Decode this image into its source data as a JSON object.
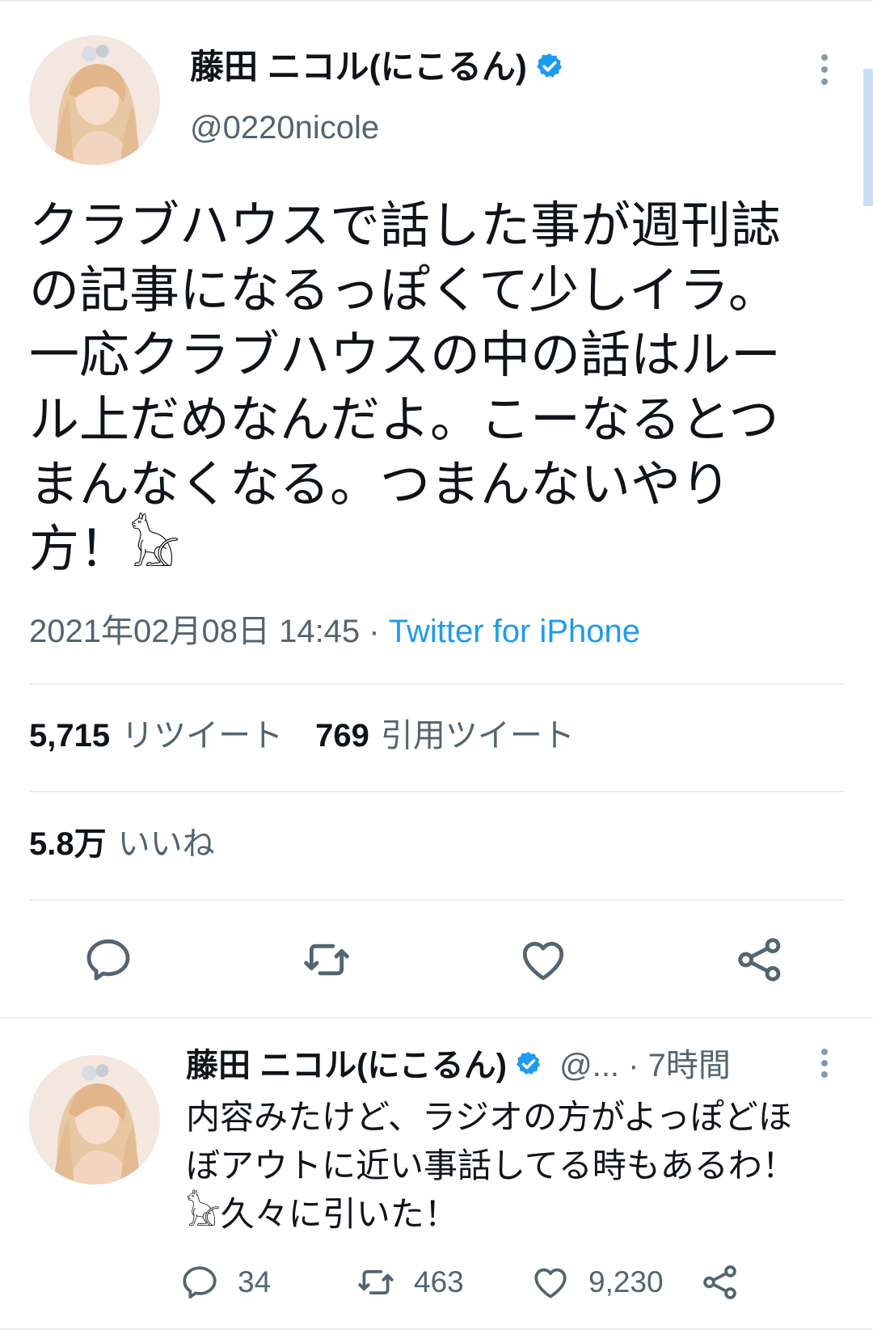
{
  "colors": {
    "accent": "#1d9bf0",
    "secondary_text": "#536471",
    "text": "#0f1419"
  },
  "tweet": {
    "author_name": "藤田 ニコル(にこるん)",
    "handle": "@0220nicole",
    "verified": true,
    "text": "クラブハウスで話した事が週刊誌\nの記事になるっぽくて少しイラ。\n一応クラブハウスの中の話はルー\nル上だめなんだよ。こーなるとつ\nまんなくなる。つまんないやり\n方！𓃠",
    "datetime": "2021年02月08日 14:45",
    "separator": " · ",
    "source": "Twitter for iPhone",
    "retweets": "5,715",
    "retweets_label": "リツイート",
    "quotes": "769",
    "quotes_label": "引用ツイート",
    "likes": "5.8万",
    "likes_label": "いいね",
    "icons": [
      "reply-icon",
      "retweet-icon",
      "like-icon",
      "share-icon",
      "verified-badge-icon",
      "more-options-icon"
    ]
  },
  "reply": {
    "author_name": "藤田 ニコル(にこるん)",
    "handle": "@...",
    "dot": " · ",
    "time": "7時間",
    "text": "内容みたけど、ラジオの方がよっぽどほ\nぼアウトに近い事話してる時もあるわ！\n𓃠久々に引いた！",
    "reply_count": "34",
    "retweet_count": "463",
    "like_count": "9,230"
  }
}
